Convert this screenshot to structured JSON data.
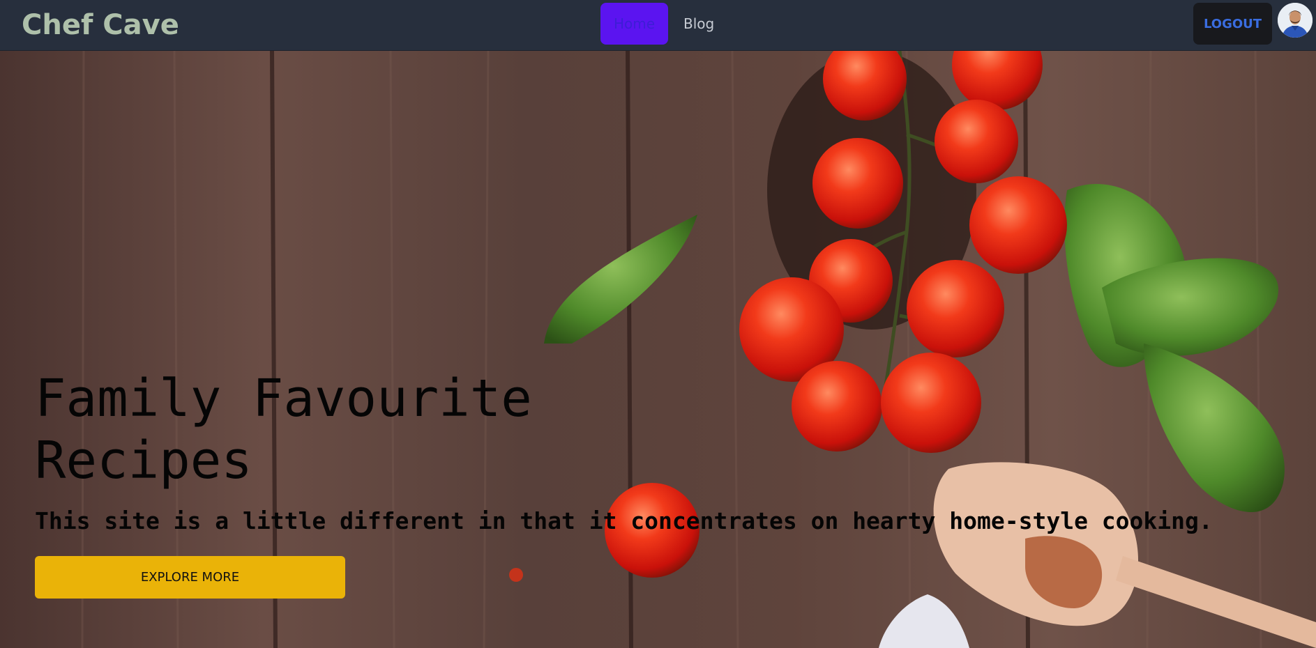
{
  "navbar": {
    "brand": "Chef Cave",
    "links": [
      {
        "label": "Home",
        "active": true
      },
      {
        "label": "Blog",
        "active": false
      }
    ],
    "logout_label": "LOGOUT",
    "accent": "#5b14f0"
  },
  "hero": {
    "title": "Family Favourite Recipes",
    "subtitle": "This site is a little different in that it concentrates on hearty home-style cooking.",
    "cta_label": "EXPLORE MORE",
    "cta_color": "#eab308"
  },
  "icons": [
    "user-avatar-icon"
  ]
}
